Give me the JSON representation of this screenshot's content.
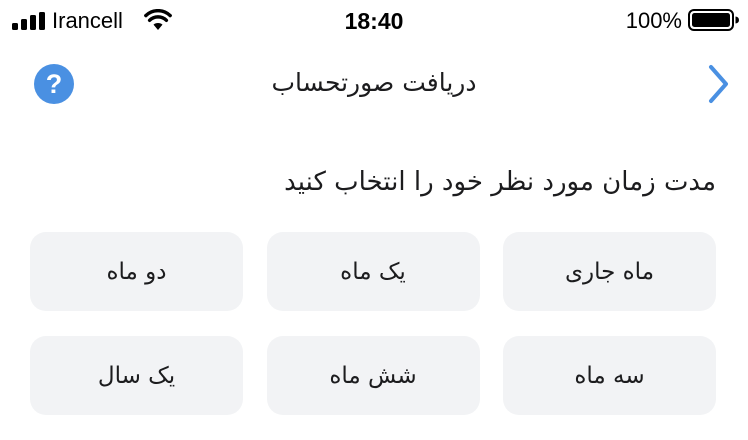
{
  "status_bar": {
    "carrier": "Irancell",
    "time": "18:40",
    "battery_percent": "100%",
    "signal_strength": 4,
    "battery_level": 1.0
  },
  "nav": {
    "title": "دریافت صورتحساب",
    "help_label": "?",
    "help_icon": "question-circle-icon",
    "back_icon": "chevron-right-icon",
    "accent_color": "#4a90e2"
  },
  "content": {
    "heading": "مدت زمان مورد نظر خود را انتخاب کنید",
    "options": [
      {
        "label": "ماه جاری"
      },
      {
        "label": "یک ماه"
      },
      {
        "label": "دو ماه"
      },
      {
        "label": "سه ماه"
      },
      {
        "label": "شش ماه"
      },
      {
        "label": "یک سال"
      }
    ],
    "option_background": "#f2f3f5"
  }
}
